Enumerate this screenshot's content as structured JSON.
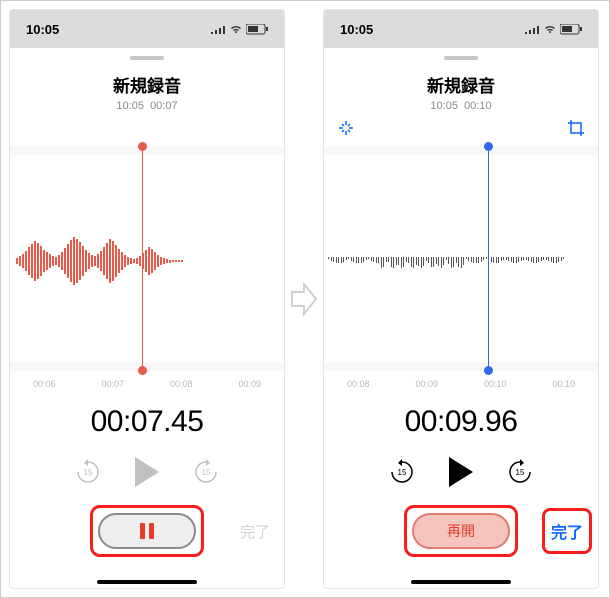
{
  "status": {
    "time": "10:05"
  },
  "left": {
    "title": "新規録音",
    "meta_time": "10:05",
    "meta_dur": "00:07",
    "ticks": [
      "00:06",
      "00:07",
      "00:08",
      "00:09"
    ],
    "big_time": "00:07.45",
    "skip_seconds": "15",
    "done": "完了"
  },
  "right": {
    "title": "新規録音",
    "meta_time": "10:05",
    "meta_dur": "00:10",
    "ticks": [
      "00:08",
      "00:09",
      "00:10",
      "00:10"
    ],
    "big_time": "00:09.96",
    "skip_seconds": "15",
    "resume": "再開",
    "done": "完了"
  }
}
